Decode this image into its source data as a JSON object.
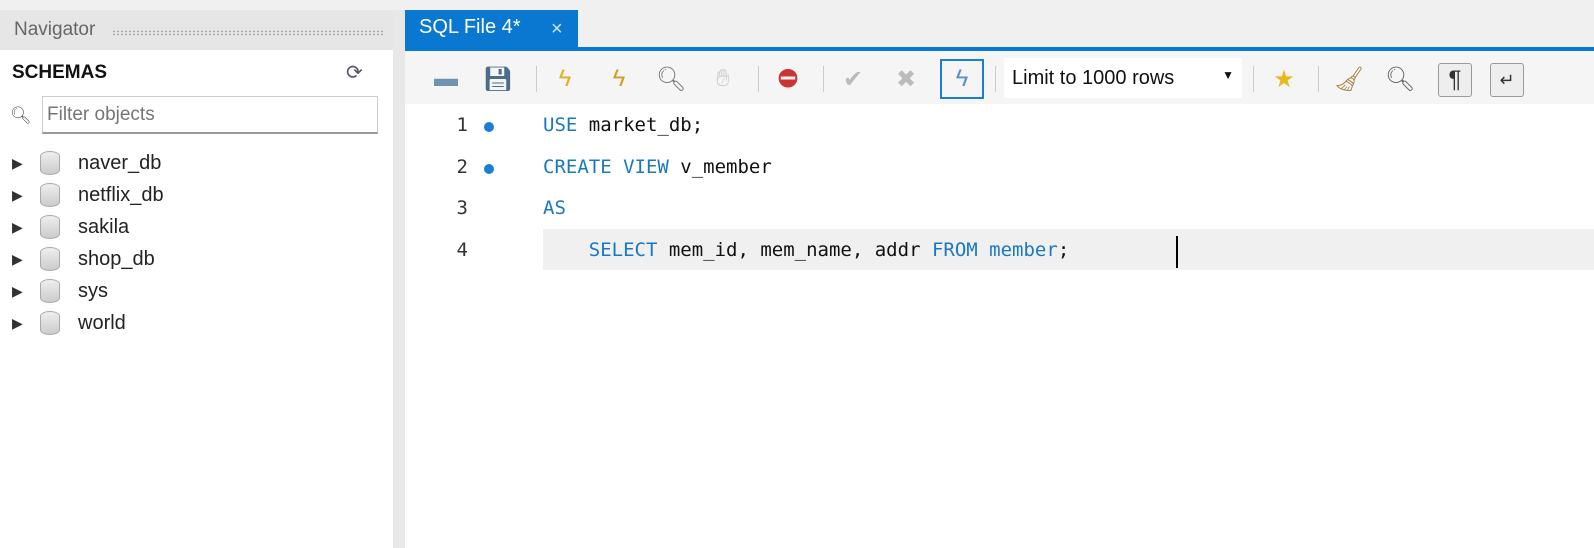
{
  "navigator": {
    "title": "Navigator",
    "section": "SCHEMAS",
    "filter_placeholder": "Filter objects",
    "schemas": [
      "naver_db",
      "netflix_db",
      "sakila",
      "shop_db",
      "sys",
      "world"
    ]
  },
  "tab": {
    "label": "SQL File 4*",
    "close": "×"
  },
  "toolbar": {
    "limit": "Limit to 1000 rows"
  },
  "editor": {
    "lines": [
      {
        "num": "1",
        "dot": true,
        "parts": [
          {
            "t": "USE",
            "kw": true
          },
          {
            "t": " market_db;"
          }
        ]
      },
      {
        "num": "2",
        "dot": true,
        "parts": [
          {
            "t": "CREATE VIEW",
            "kw": true
          },
          {
            "t": " v_member"
          }
        ]
      },
      {
        "num": "3",
        "dot": false,
        "parts": [
          {
            "t": "AS",
            "kw": true
          }
        ]
      },
      {
        "num": "4",
        "dot": false,
        "parts": [
          {
            "t": "    "
          },
          {
            "t": "SELECT",
            "kw": true
          },
          {
            "t": " mem_id, mem_name, addr "
          },
          {
            "t": "FROM",
            "kw": true
          },
          {
            "t": " "
          },
          {
            "t": "member",
            "kw": true
          },
          {
            "t": ";"
          }
        ]
      }
    ]
  }
}
